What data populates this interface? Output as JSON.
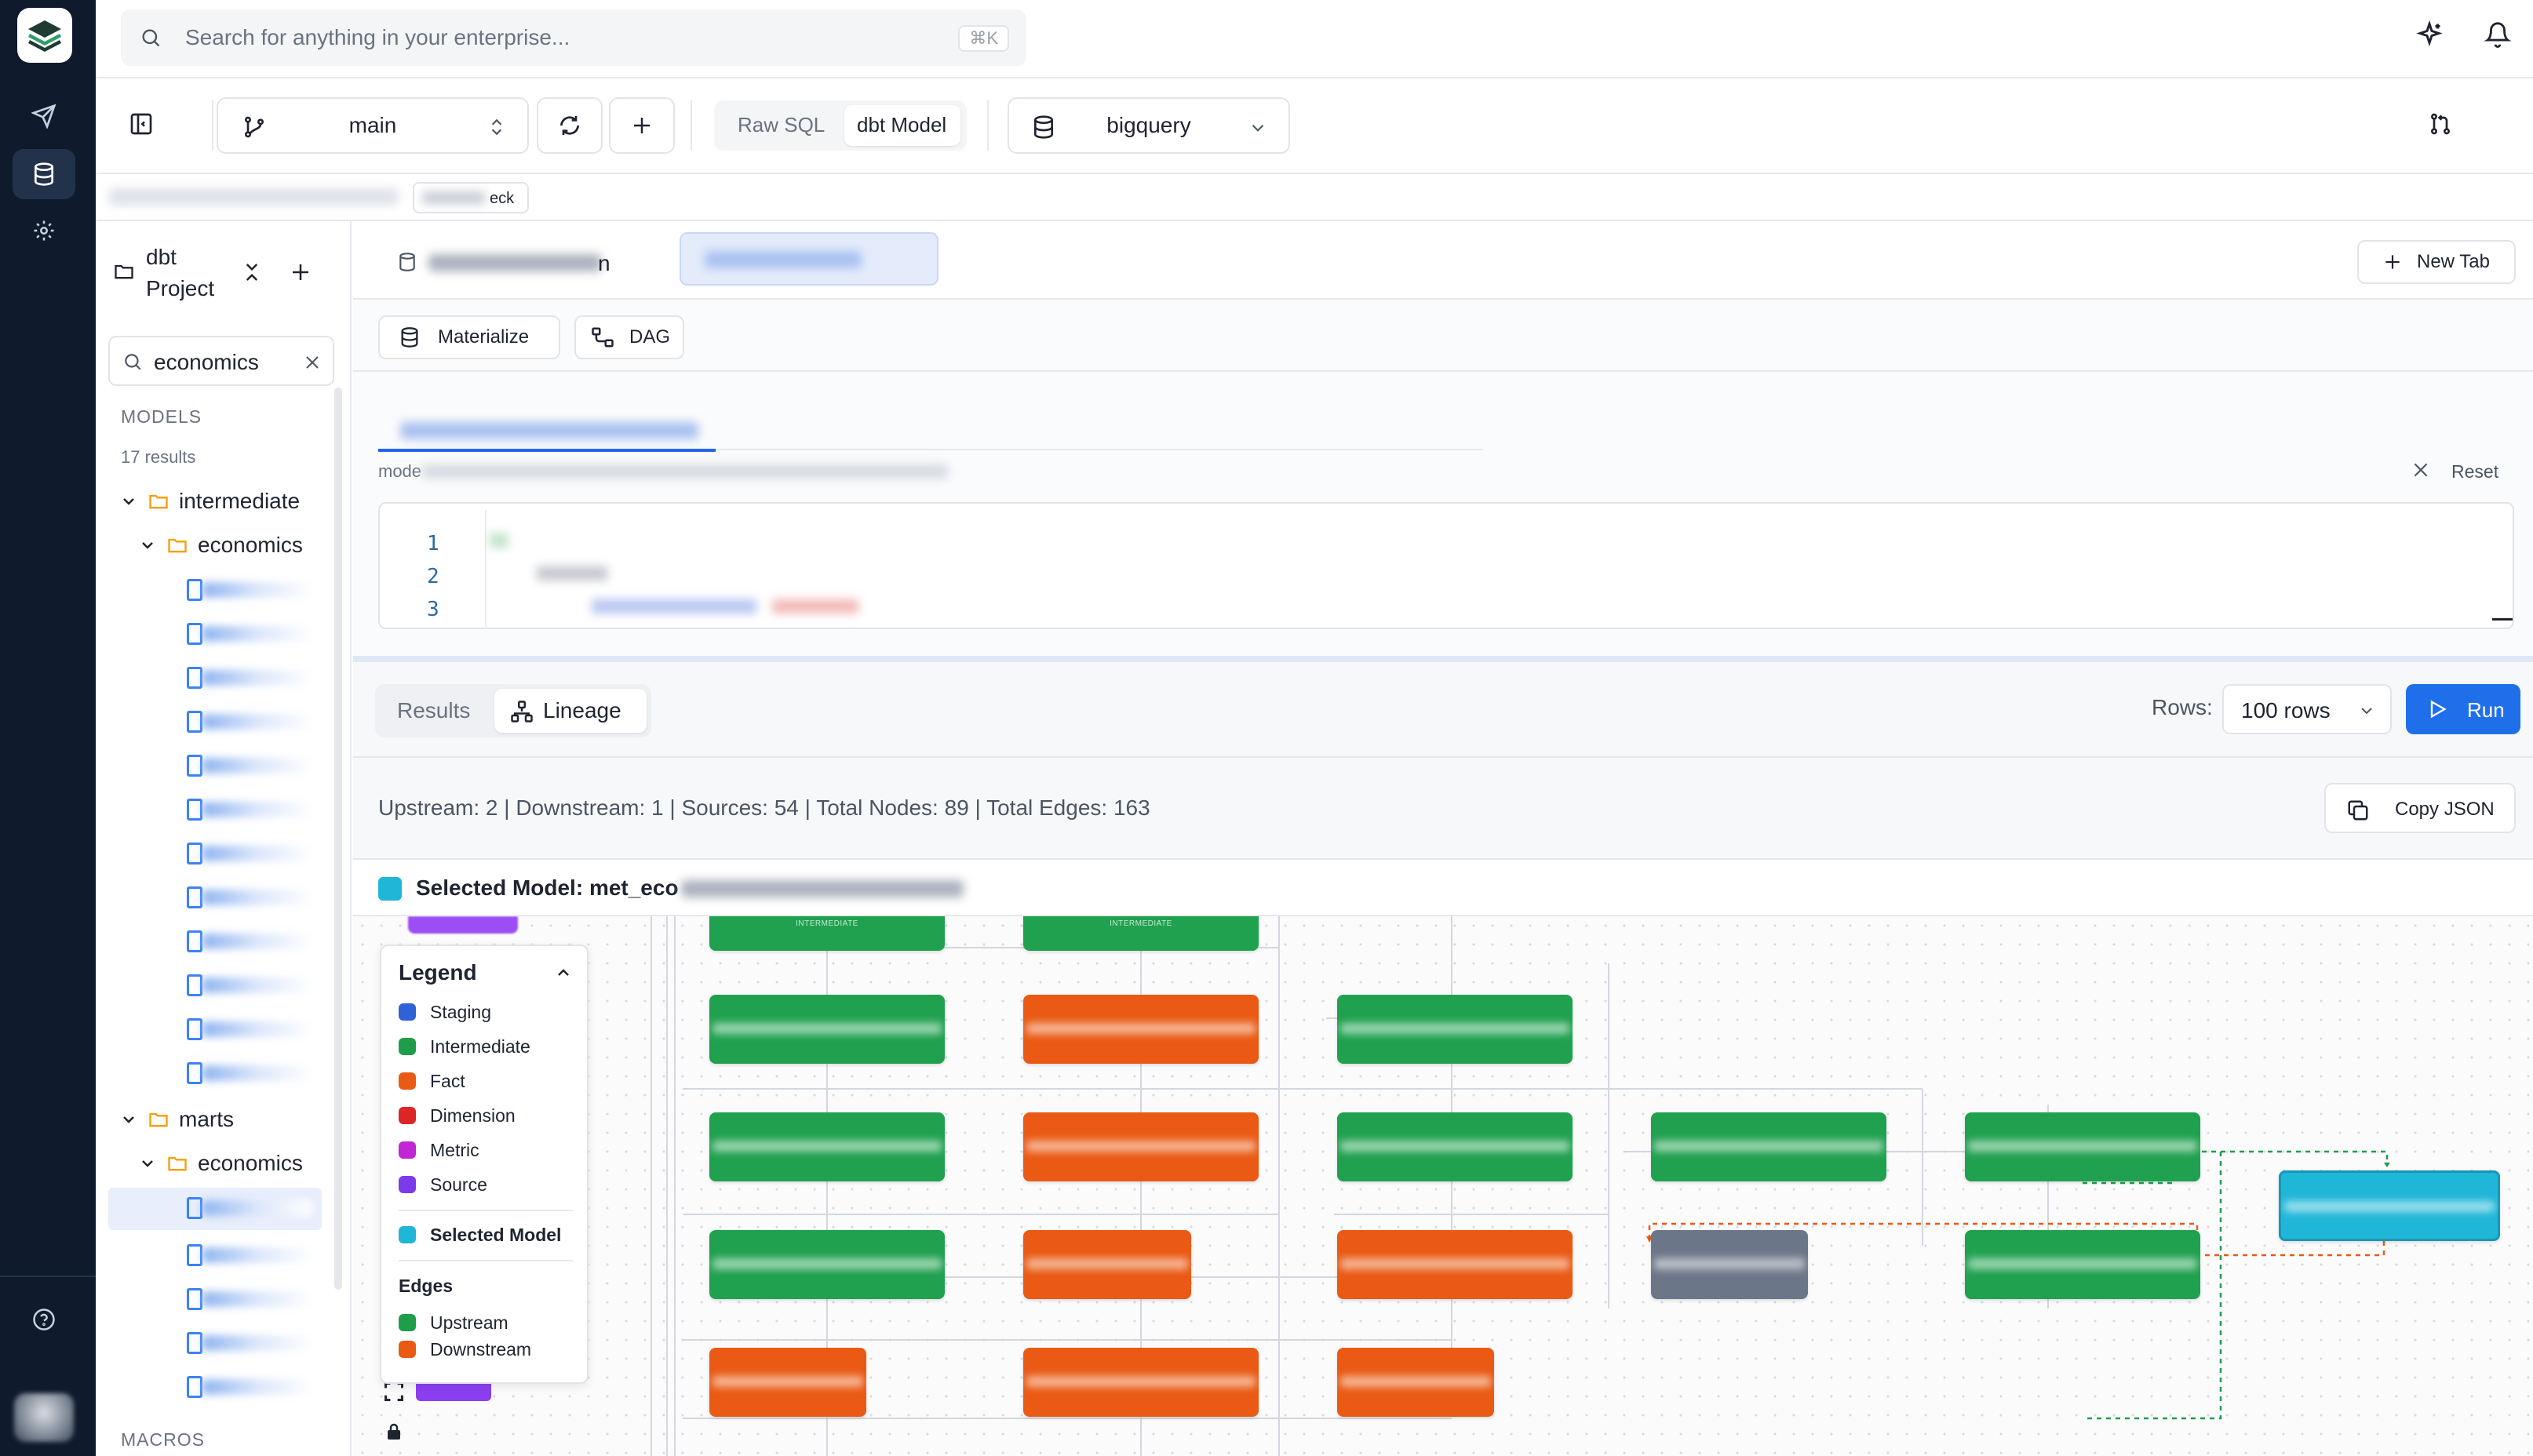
{
  "topbar": {
    "search_placeholder": "Search for anything in your enterprise...",
    "search_shortcut": "⌘K"
  },
  "toolbar": {
    "branch": "main",
    "mode_raw": "Raw SQL",
    "mode_dbt": "dbt Model",
    "warehouse": "bigquery"
  },
  "breadcrumbs": {
    "chip_tail": "eck"
  },
  "explorer": {
    "title_line1": "dbt",
    "title_line2": "Project",
    "search_value": "economics",
    "section_models": "MODELS",
    "results_count": "17 results",
    "folder_intermediate": "intermediate",
    "folder_economics_1": "economics",
    "folder_marts": "marts",
    "folder_economics_2": "economics",
    "section_macros": "MACROS"
  },
  "tabs": {
    "new_tab": "New Tab",
    "tab1_tail": "n"
  },
  "actions": {
    "materialize": "Materialize",
    "dag": "DAG"
  },
  "editor": {
    "path_prefix": "mode",
    "reset": "Reset",
    "line_numbers": [
      "1",
      "2",
      "3"
    ]
  },
  "results": {
    "tab_results": "Results",
    "tab_lineage": "Lineage",
    "rows_label": "Rows:",
    "rows_value": "100 rows",
    "run": "Run"
  },
  "lineage": {
    "stats": "Upstream: 2 | Downstream: 1 | Sources: 54 | Total Nodes: 89 | Total Edges: 163",
    "copy_json": "Copy JSON",
    "selected_prefix": "Selected Model: met_eco",
    "node_tag": "INTERMEDIATE"
  },
  "legend": {
    "title": "Legend",
    "items": [
      {
        "label": "Staging",
        "color": "#2f62d6"
      },
      {
        "label": "Intermediate",
        "color": "#1e9e4a"
      },
      {
        "label": "Fact",
        "color": "#ea5a14"
      },
      {
        "label": "Dimension",
        "color": "#dc2626"
      },
      {
        "label": "Metric",
        "color": "#c026d3"
      },
      {
        "label": "Source",
        "color": "#7c3aed"
      }
    ],
    "selected_label": "Selected Model",
    "selected_color": "#1fb6d8",
    "edges_title": "Edges",
    "edge_upstream": "Upstream",
    "edge_upstream_color": "#1e9e4a",
    "edge_downstream": "Downstream",
    "edge_downstream_color": "#ea5a14"
  },
  "colors": {
    "accent": "#1f6feb",
    "intermediate": "#20a14f",
    "fact": "#ea5a14",
    "staging_gray": "#6b7789",
    "selected": "#1fb6d8",
    "source": "#8b3ff0"
  }
}
